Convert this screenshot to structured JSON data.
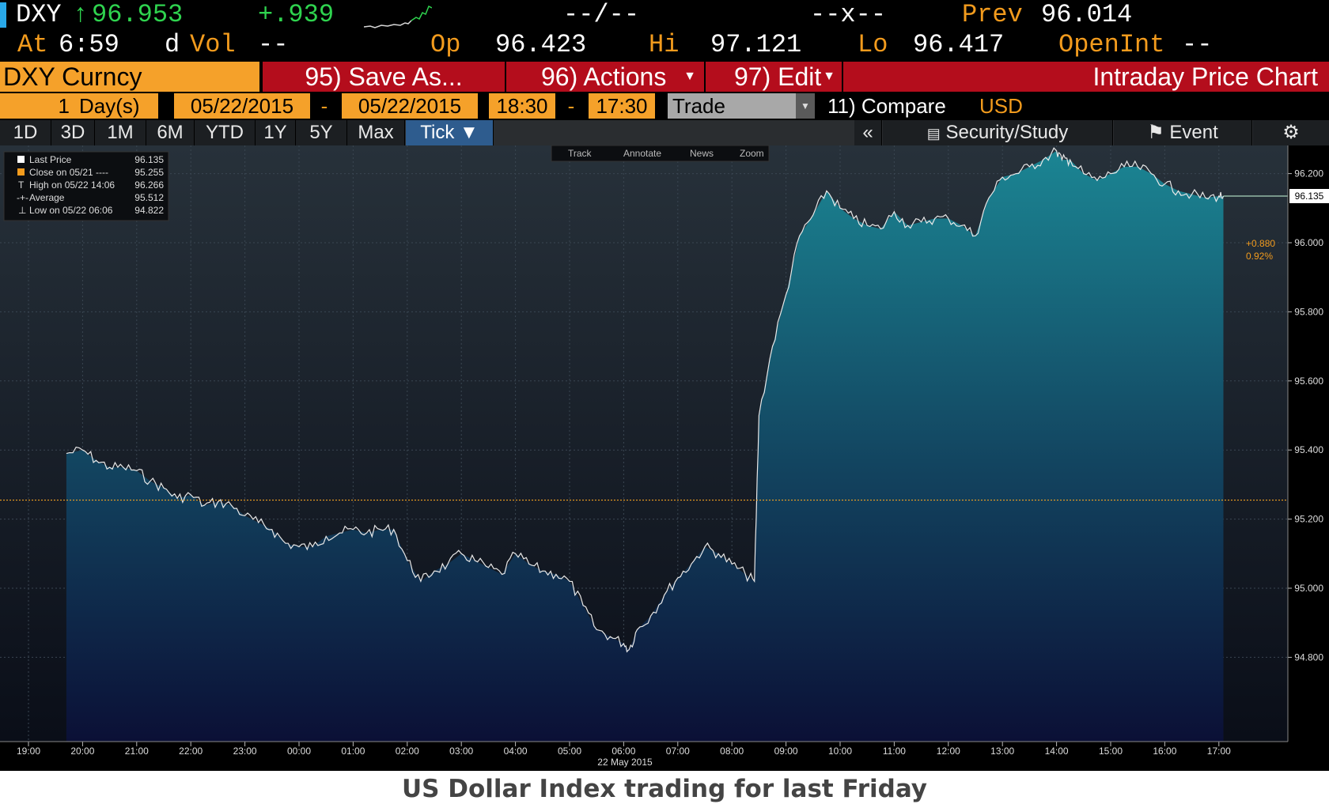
{
  "quote": {
    "ticker": "DXY",
    "arrow": "↑",
    "last": "96.953",
    "change": "+.939",
    "bid_ask": "--/--",
    "size": "--x--",
    "prev_label": "Prev",
    "prev": "96.014",
    "at_label": "At",
    "time": "6:59",
    "d_label": "d",
    "vol_label": "Vol",
    "vol": "--",
    "op_label": "Op",
    "op": "96.423",
    "hi_label": "Hi",
    "hi": "97.121",
    "lo_label": "Lo",
    "lo": "96.417",
    "openint_label": "OpenInt",
    "openint": "--"
  },
  "toolbar": {
    "security": "DXY Curncy",
    "save_as": "95) Save As...",
    "actions": "96) Actions",
    "edit": "97) Edit",
    "title": "Intraday Price Chart"
  },
  "range": {
    "count": "1",
    "unit": "Day(s)",
    "start_date": "05/22/2015",
    "dash1": "-",
    "end_date": "05/22/2015",
    "start_time": "18:30",
    "dash2": "-",
    "end_time": "17:30",
    "mode": "Trade",
    "compare": "11) Compare",
    "currency": "USD"
  },
  "tabs": [
    "1D",
    "3D",
    "1M",
    "6M",
    "YTD",
    "1Y",
    "5Y",
    "Max",
    "Tick ▼"
  ],
  "right_tabs": {
    "collapse": "«",
    "security_study": "Security/Study",
    "event": "Event"
  },
  "chart_toolbar": [
    "Track",
    "Annotate",
    "News",
    "Zoom"
  ],
  "legend": [
    {
      "label": "Last Price",
      "value": "96.135"
    },
    {
      "label": "Close on 05/21 ----",
      "value": "95.255"
    },
    {
      "label": "High on 05/22 14:06",
      "value": "96.266"
    },
    {
      "label": "Average",
      "value": "95.512"
    },
    {
      "label": "Low on 05/22 06:06",
      "value": "94.822"
    }
  ],
  "change_label": {
    "abs": "+0.880",
    "pct": "0.92%"
  },
  "last_tag": "96.135",
  "date_label": "22 May 2015",
  "caption": "US Dollar Index trading for last Friday",
  "colors": {
    "amber": "#f29b1d",
    "red": "#b40d1c",
    "fill_top": "#1b8593",
    "fill_bottom": "#0b1036",
    "close_line": "#f0a020"
  },
  "chart_data": {
    "type": "area",
    "x_ticks": [
      "19:00",
      "20:00",
      "21:00",
      "22:00",
      "23:00",
      "00:00",
      "01:00",
      "02:00",
      "03:00",
      "04:00",
      "05:00",
      "06:00",
      "07:00",
      "08:00",
      "09:00",
      "10:00",
      "11:00",
      "12:00",
      "13:00",
      "14:00",
      "15:00",
      "16:00",
      "17:00"
    ],
    "y_ticks": [
      "94.800",
      "95.000",
      "95.200",
      "95.400",
      "95.600",
      "95.800",
      "96.000",
      "96.200"
    ],
    "ylim": [
      94.75,
      96.4
    ],
    "reference_line": {
      "name": "Close on 05/21",
      "value": 95.255
    },
    "series": [
      {
        "x": [
          "19:42",
          "20:00",
          "20:15",
          "20:30",
          "20:45",
          "21:00",
          "21:15",
          "21:30",
          "21:45",
          "22:00",
          "22:15",
          "22:30",
          "22:45",
          "23:00",
          "23:15",
          "23:30",
          "23:45",
          "00:00",
          "00:15",
          "00:30",
          "00:45",
          "01:00",
          "01:15",
          "01:30",
          "01:45",
          "02:00",
          "02:15",
          "02:30",
          "02:45",
          "03:00",
          "03:15",
          "03:30",
          "03:45",
          "04:00",
          "04:15",
          "04:30",
          "04:45",
          "05:00",
          "05:15",
          "05:30",
          "05:45",
          "06:00",
          "06:06",
          "06:15",
          "06:30",
          "06:45",
          "07:00",
          "07:15",
          "07:30",
          "07:45",
          "08:00",
          "08:15",
          "08:25",
          "08:30",
          "08:45",
          "09:00",
          "09:15",
          "09:30",
          "09:45",
          "10:00",
          "10:15",
          "10:30",
          "10:45",
          "11:00",
          "11:15",
          "11:30",
          "11:45",
          "12:00",
          "12:15",
          "12:30",
          "12:45",
          "13:00",
          "13:15",
          "13:30",
          "13:45",
          "14:00",
          "14:06",
          "14:15",
          "14:30",
          "14:45",
          "15:00",
          "15:15",
          "15:30",
          "15:45",
          "16:00",
          "16:15",
          "16:30",
          "16:45",
          "17:00",
          "17:05"
        ],
        "y": [
          95.39,
          95.4,
          95.37,
          95.35,
          95.35,
          95.34,
          95.31,
          95.29,
          95.26,
          95.27,
          95.24,
          95.25,
          95.24,
          95.21,
          95.19,
          95.17,
          95.13,
          95.12,
          95.12,
          95.15,
          95.16,
          95.17,
          95.16,
          95.17,
          95.17,
          95.08,
          95.02,
          95.05,
          95.07,
          95.1,
          95.08,
          95.06,
          95.04,
          95.1,
          95.07,
          95.05,
          95.04,
          95.02,
          94.95,
          94.88,
          94.86,
          94.84,
          94.822,
          94.88,
          94.92,
          94.98,
          95.03,
          95.07,
          95.12,
          95.1,
          95.07,
          95.04,
          95.02,
          95.5,
          95.7,
          95.85,
          96.02,
          96.08,
          96.15,
          96.1,
          96.07,
          96.05,
          96.04,
          96.09,
          96.05,
          96.06,
          96.07,
          96.07,
          96.05,
          96.02,
          96.13,
          96.19,
          96.2,
          96.22,
          96.24,
          96.266,
          96.24,
          96.24,
          96.2,
          96.18,
          96.2,
          96.22,
          96.22,
          96.2,
          96.17,
          96.15,
          96.14,
          96.13,
          96.135,
          96.135
        ]
      }
    ]
  }
}
